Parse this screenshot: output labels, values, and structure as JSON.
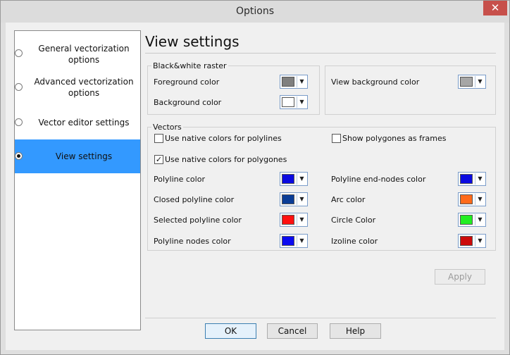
{
  "window": {
    "title": "Options",
    "close_glyph": "✕"
  },
  "sidebar": {
    "items": [
      {
        "label": "General vectorization options",
        "selected": false
      },
      {
        "label": "Advanced vectorization options",
        "selected": false
      },
      {
        "label": "Vector editor settings",
        "selected": false
      },
      {
        "label": "View settings",
        "selected": true
      }
    ]
  },
  "page": {
    "title": "View settings"
  },
  "raster_group": {
    "label": "Black&white raster",
    "foreground_label": "Foreground color",
    "foreground_color": "#7f7f7f",
    "background_label": "Background color",
    "background_color": "#ffffff"
  },
  "view_group": {
    "view_background_label": "View background color",
    "view_background_color": "#a6a6a6"
  },
  "vectors_group": {
    "label": "Vectors",
    "native_polylines_label": "Use native colors for polylines",
    "native_polylines_checked": false,
    "show_polygons_frames_label": "Show polygones as frames",
    "show_polygons_frames_checked": false,
    "native_polygones_label": "Use native colors for polygones",
    "native_polygones_checked": true,
    "check_glyph": "✓",
    "colors": {
      "polyline_label": "Polyline color",
      "polyline": "#0a0ae0",
      "closed_polyline_label": "Closed polyline color",
      "closed_polyline": "#0a3c96",
      "selected_polyline_label": "Selected polyline color",
      "selected_polyline": "#ff1010",
      "polyline_nodes_label": "Polyline nodes color",
      "polyline_nodes": "#0a0af0",
      "polyline_end_nodes_label": "Polyline end-nodes color",
      "polyline_end_nodes": "#0a0ae0",
      "arc_label": "Arc color",
      "arc": "#ff6a1a",
      "circle_label": "Circle Color",
      "circle": "#22ee22",
      "izoline_label": "Izoline color",
      "izoline": "#cc0a0a"
    }
  },
  "buttons": {
    "apply": "Apply",
    "ok": "OK",
    "cancel": "Cancel",
    "help": "Help"
  },
  "dropdown_glyph": "▼"
}
